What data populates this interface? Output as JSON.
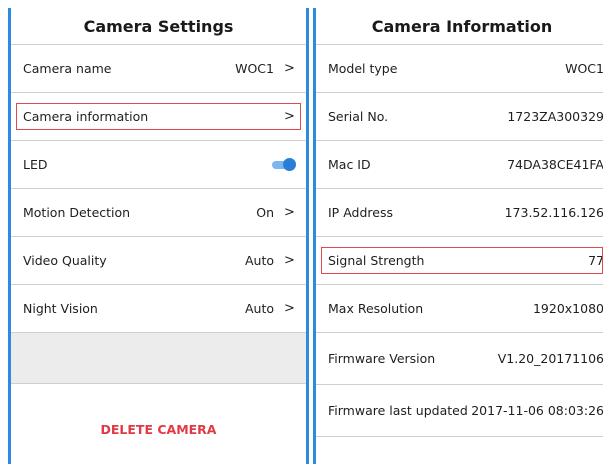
{
  "settings": {
    "title": "Camera Settings",
    "rows": [
      {
        "label": "Camera name",
        "value": "WOC1",
        "chevron": ">"
      },
      {
        "label": "Camera information",
        "value": "",
        "chevron": ">"
      },
      {
        "label": "LED",
        "toggle_on": true
      },
      {
        "label": "Motion Detection",
        "value": "On",
        "chevron": ">"
      },
      {
        "label": "Video Quality",
        "value": "Auto",
        "chevron": ">"
      },
      {
        "label": "Night Vision",
        "value": "Auto",
        "chevron": ">"
      }
    ],
    "delete_label": "DELETE CAMERA"
  },
  "info": {
    "title": "Camera Information",
    "rows": [
      {
        "label": "Model type",
        "value": "WOC1"
      },
      {
        "label": "Serial No.",
        "value": "1723ZA300329"
      },
      {
        "label": "Mac ID",
        "value": "74DA38CE41FA"
      },
      {
        "label": "IP Address",
        "value": "173.52.116.126"
      },
      {
        "label": "Signal Strength",
        "value": "77"
      },
      {
        "label": "Max Resolution",
        "value": "1920x1080"
      },
      {
        "label": "Firmware Version",
        "value": "V1.20_20171106"
      },
      {
        "label": "Firmware last updated",
        "value": "2017-11-06 08:03:26"
      }
    ]
  },
  "colors": {
    "accent": "#2b8be0",
    "highlight_border": "#e04a4a",
    "delete_text": "#e03a46",
    "toggle_knob": "#2b7ed8"
  }
}
